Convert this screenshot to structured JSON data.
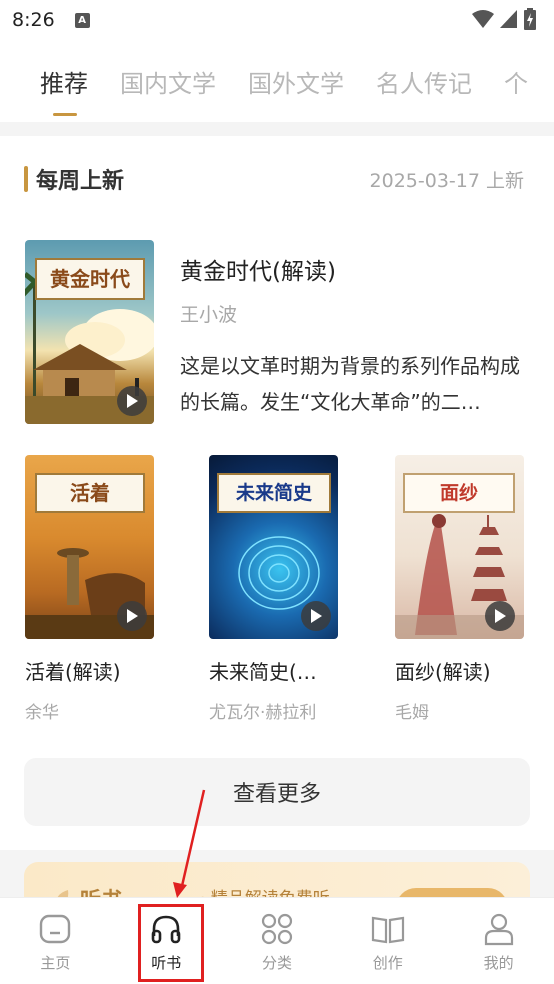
{
  "status_bar": {
    "time": "8:26",
    "notification_icon": "a-icon"
  },
  "tabs": [
    {
      "label": "推荐",
      "active": true
    },
    {
      "label": "国内文学",
      "active": false
    },
    {
      "label": "国外文学",
      "active": false
    },
    {
      "label": "名人传记",
      "active": false
    },
    {
      "label": "个",
      "active": false
    }
  ],
  "section": {
    "title": "每周上新",
    "date": "2025-03-17 上新"
  },
  "featured": {
    "cover_title": "黄金时代",
    "title": "黄金时代(解读)",
    "author": "王小波",
    "description": "这是以文革时期为背景的系列作品构成的长篇。发生“文化大革命”的二…"
  },
  "books": [
    {
      "cover_title": "活着",
      "title": "活着(解读)",
      "author": "余华"
    },
    {
      "cover_title": "未来简史",
      "title": "未来简史(…",
      "author": "尤瓦尔·赫拉利"
    },
    {
      "cover_title": "面纱",
      "title": "面纱(解读)",
      "author": "毛姆"
    }
  ],
  "more_button": "查看更多",
  "promo": {
    "title": "听书",
    "subtitle": "· 精品解读免费听"
  },
  "bottom_nav": [
    {
      "label": "主页",
      "icon": "home-icon"
    },
    {
      "label": "听书",
      "icon": "headphones-icon",
      "active": true
    },
    {
      "label": "分类",
      "icon": "category-icon"
    },
    {
      "label": "创作",
      "icon": "book-open-icon"
    },
    {
      "label": "我的",
      "icon": "person-icon"
    }
  ],
  "colors": {
    "accent": "#c89640",
    "highlight": "#e02020"
  }
}
